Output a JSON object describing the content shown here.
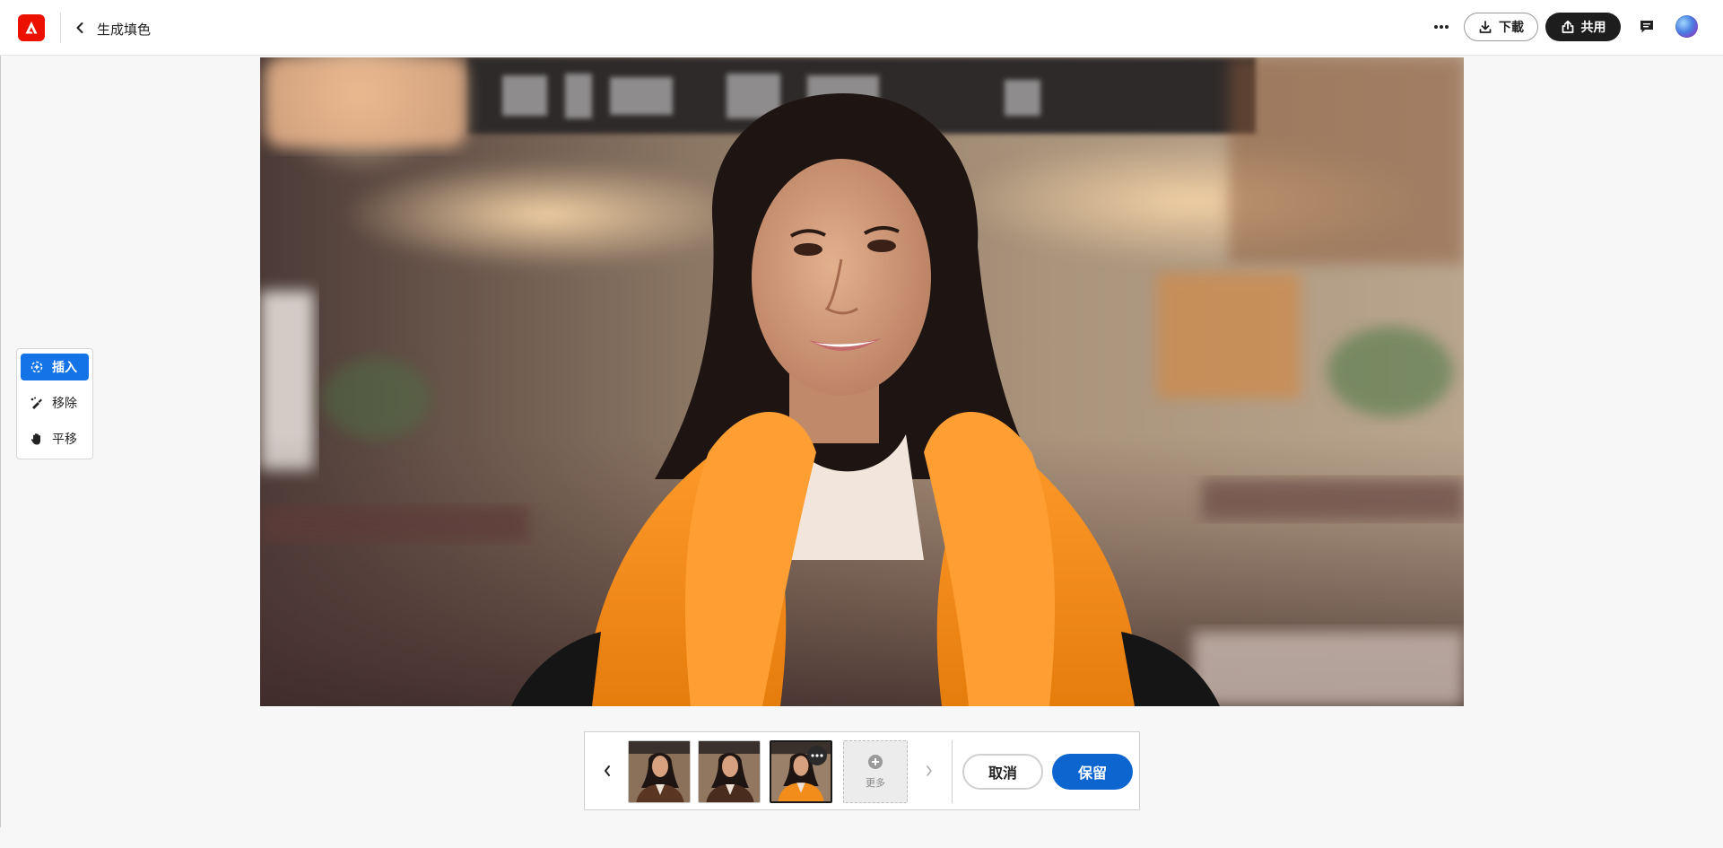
{
  "header": {
    "title": "生成填色",
    "download_label": "下載",
    "share_label": "共用"
  },
  "canvas": {
    "image": "portrait-woman-orange-coat-cafe"
  },
  "tools": [
    {
      "label": "插入",
      "icon": "insert-brush-icon",
      "active": true
    },
    {
      "label": "移除",
      "icon": "remove-brush-icon",
      "active": false
    },
    {
      "label": "平移",
      "icon": "hand-pan-icon",
      "active": false
    }
  ],
  "variations": {
    "thumbnails": [
      {
        "name": "variation-1-brown-coat",
        "selected": false
      },
      {
        "name": "variation-2-brown-coat",
        "selected": false
      },
      {
        "name": "variation-3-orange-coat",
        "selected": true
      }
    ],
    "more_label": "更多"
  },
  "actions": {
    "cancel_label": "取消",
    "keep_label": "保留"
  },
  "colors": {
    "brand_red": "#eb1000",
    "accent_blue": "#1473e6",
    "keep_blue": "#0d66d0",
    "share_dark": "#1d1d1d"
  }
}
